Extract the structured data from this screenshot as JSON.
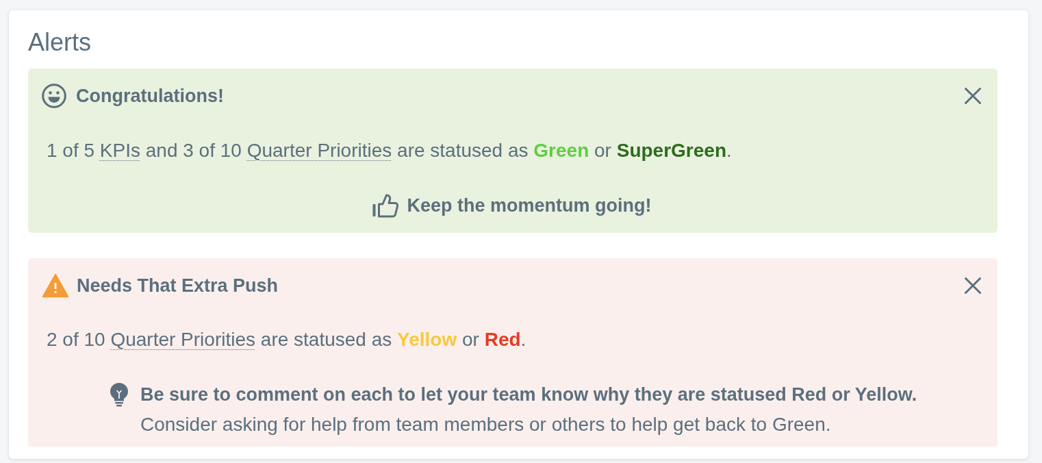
{
  "title": "Alerts",
  "alerts": [
    {
      "kind": "success",
      "title": "Congratulations!",
      "dismissible": true,
      "message": [
        {
          "kind": "text",
          "text": "1 of 5 "
        },
        {
          "kind": "link",
          "text": "KPIs"
        },
        {
          "kind": "text",
          "text": " and 3 of 10 "
        },
        {
          "kind": "link",
          "text": "Quarter Priorities"
        },
        {
          "kind": "text",
          "text": " are statused as "
        },
        {
          "kind": "status",
          "text": "Green",
          "color": "#62cc45"
        },
        {
          "kind": "text",
          "text": " or "
        },
        {
          "kind": "status",
          "text": "SuperGreen",
          "color": "#2e6b1f"
        },
        {
          "kind": "text",
          "text": "."
        }
      ],
      "footer": {
        "kind": "cheer",
        "text": "Keep the momentum going!"
      }
    },
    {
      "kind": "warning",
      "title": "Needs That Extra Push",
      "dismissible": true,
      "message": [
        {
          "kind": "text",
          "text": "2 of 10 "
        },
        {
          "kind": "link",
          "text": "Quarter Priorities"
        },
        {
          "kind": "text",
          "text": " are statused as "
        },
        {
          "kind": "status",
          "text": "Yellow",
          "color": "#f8c93e"
        },
        {
          "kind": "text",
          "text": " or "
        },
        {
          "kind": "status",
          "text": "Red",
          "color": "#e83a23"
        },
        {
          "kind": "text",
          "text": "."
        }
      ],
      "footer": {
        "kind": "tip",
        "heading": "Be sure to comment on each to let your team know why they are statused Red or Yellow.",
        "text": "Consider asking for help from team members or others to help get back to Green."
      }
    }
  ]
}
